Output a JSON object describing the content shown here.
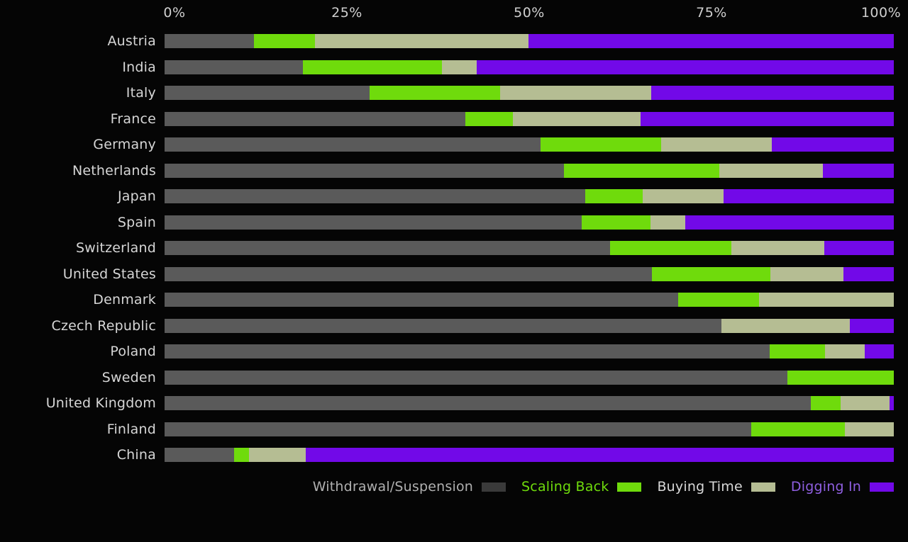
{
  "chart_data": {
    "type": "bar",
    "orientation": "horizontal",
    "stacked": true,
    "stack_normalized": true,
    "title": "",
    "subtitle": "",
    "xlabel": "",
    "ylabel": "",
    "xlim": [
      0,
      100
    ],
    "grid": false,
    "legend_position": "bottom-right",
    "axis_ticks": [
      {
        "label": "0%",
        "value": 0
      },
      {
        "label": "25%",
        "value": 25
      },
      {
        "label": "50%",
        "value": 50
      },
      {
        "label": "75%",
        "value": 75
      },
      {
        "label": "100%",
        "value": 100
      }
    ],
    "tick_labels": [
      "0%",
      "25%",
      "50%",
      "75%",
      "100%"
    ],
    "categories": [
      "Austria",
      "India",
      "Italy",
      "France",
      "Germany",
      "Netherlands",
      "Japan",
      "Spain",
      "Switzerland",
      "United States",
      "Denmark",
      "Czech Republic",
      "Poland",
      "Sweden",
      "United Kingdom",
      "Finland",
      "China"
    ],
    "series": [
      {
        "name": "Withdrawal/Suspension",
        "color": "#5a5a5a",
        "legend_swatch_color": "#3a3a3a",
        "legend_text_color": "#b0b0b0",
        "values": [
          12.3,
          19.0,
          28.1,
          41.2,
          51.6,
          54.8,
          57.7,
          57.2,
          61.1,
          66.8,
          70.4,
          76.4,
          83.0,
          85.4,
          88.6,
          80.4,
          9.5
        ]
      },
      {
        "name": "Scaling Back",
        "color": "#6fdb0c",
        "legend_swatch_color": "#6fdb0c",
        "legend_text_color": "#6fdb0c",
        "values": [
          8.3,
          19.0,
          17.9,
          6.6,
          16.5,
          21.3,
          7.9,
          9.4,
          16.6,
          16.3,
          11.1,
          0.0,
          7.6,
          14.6,
          4.1,
          12.9,
          2.1
        ]
      },
      {
        "name": "Buying Time",
        "color": "#b5bd93",
        "legend_swatch_color": "#b5bd93",
        "legend_text_color": "#d8d8d8",
        "values": [
          29.3,
          4.8,
          20.7,
          17.5,
          15.2,
          14.2,
          11.1,
          4.8,
          12.8,
          10.0,
          18.5,
          17.6,
          5.4,
          0.0,
          6.7,
          6.7,
          7.8
        ]
      },
      {
        "name": "Digging In",
        "color": "#7209e8",
        "legend_swatch_color": "#7209e8",
        "legend_text_color": "#8f5fe0",
        "values": [
          50.1,
          57.2,
          33.3,
          34.7,
          16.7,
          9.7,
          23.3,
          28.6,
          9.5,
          6.9,
          0.0,
          6.0,
          4.0,
          0.0,
          0.6,
          0.0,
          80.6
        ]
      }
    ],
    "rows": [
      {
        "label": "Austria",
        "values": [
          12.3,
          8.3,
          29.3,
          50.1
        ]
      },
      {
        "label": "India",
        "values": [
          19.0,
          19.0,
          4.8,
          57.2
        ]
      },
      {
        "label": "Italy",
        "values": [
          28.1,
          17.9,
          20.7,
          33.3
        ]
      },
      {
        "label": "France",
        "values": [
          41.2,
          6.6,
          17.5,
          34.7
        ]
      },
      {
        "label": "Germany",
        "values": [
          51.6,
          16.5,
          15.2,
          16.7
        ]
      },
      {
        "label": "Netherlands",
        "values": [
          54.8,
          21.3,
          14.2,
          9.7
        ]
      },
      {
        "label": "Japan",
        "values": [
          57.7,
          7.9,
          11.1,
          23.3
        ]
      },
      {
        "label": "Spain",
        "values": [
          57.2,
          9.4,
          4.8,
          28.6
        ]
      },
      {
        "label": "Switzerland",
        "values": [
          61.1,
          16.6,
          12.8,
          9.5
        ]
      },
      {
        "label": "United States",
        "values": [
          66.8,
          16.3,
          10.0,
          6.9
        ]
      },
      {
        "label": "Denmark",
        "values": [
          70.4,
          11.1,
          18.5,
          0.0
        ]
      },
      {
        "label": "Czech Republic",
        "values": [
          76.4,
          0.0,
          17.6,
          6.0
        ]
      },
      {
        "label": "Poland",
        "values": [
          83.0,
          7.6,
          5.4,
          4.0
        ]
      },
      {
        "label": "Sweden",
        "values": [
          85.4,
          14.6,
          0.0,
          0.0
        ]
      },
      {
        "label": "United Kingdom",
        "values": [
          88.6,
          4.1,
          6.7,
          0.6
        ]
      },
      {
        "label": "Finland",
        "values": [
          80.4,
          12.9,
          6.7,
          0.0
        ]
      },
      {
        "label": "China",
        "values": [
          9.5,
          2.1,
          7.8,
          80.6
        ]
      }
    ]
  },
  "colors": {
    "background": "#050505",
    "text": "#d8d8d8",
    "withdrawal_suspension": "#5a5a5a",
    "scaling_back": "#6fdb0c",
    "buying_time": "#b5bd93",
    "digging_in": "#7209e8"
  }
}
